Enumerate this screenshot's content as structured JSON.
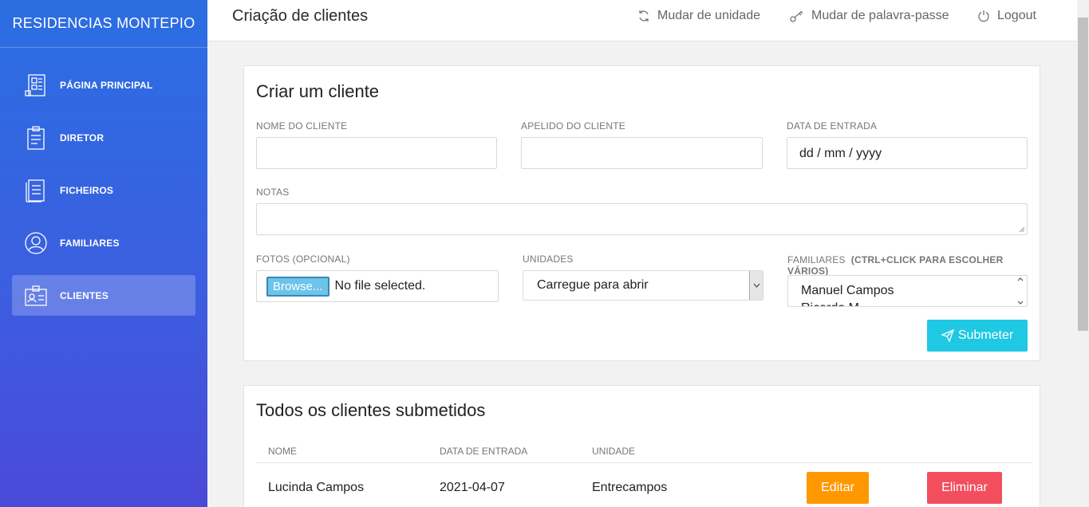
{
  "brand": "RESIDENCIAS MONTEPIO",
  "sidebar": {
    "items": [
      {
        "label": "PÁGINA PRINCIPAL",
        "icon": "dashboard-icon"
      },
      {
        "label": "DIRETOR",
        "icon": "clipboard-icon"
      },
      {
        "label": "FICHEIROS",
        "icon": "document-icon"
      },
      {
        "label": "FAMILIARES",
        "icon": "user-icon"
      },
      {
        "label": "CLIENTES",
        "icon": "id-card-icon",
        "active": true
      }
    ]
  },
  "header": {
    "title": "Criação de clientes",
    "change_unit": "Mudar de unidade",
    "change_password": "Mudar de palavra-passe",
    "logout": "Logout"
  },
  "create_form": {
    "title": "Criar um cliente",
    "name_label": "NOME DO CLIENTE",
    "name_value": "",
    "surname_label": "APELIDO DO CLIENTE",
    "surname_value": "",
    "entry_date_label": "DATA DE ENTRADA",
    "entry_date_placeholder": "dd / mm / yyyy",
    "notes_label": "NOTAS",
    "notes_value": "",
    "photos_label": "FOTOS (OPCIONAL)",
    "browse_label": "Browse...",
    "file_status": "No file selected.",
    "units_label": "UNIDADES",
    "units_selected": "Carregue para abrir",
    "family_label": "FAMILIARES",
    "family_hint": "(CTRL+CLICK PARA ESCOLHER VÁRIOS)",
    "family_options": [
      "Manuel Campos",
      "Ricardo M..."
    ],
    "submit_label": "Submeter"
  },
  "clients_table": {
    "title": "Todos os clientes submetidos",
    "columns": [
      "NOME",
      "DATA DE ENTRADA",
      "UNIDADE"
    ],
    "rows": [
      {
        "name": "Lucinda Campos",
        "entry_date": "2021-04-07",
        "unit": "Entrecampos",
        "edit": "Editar",
        "delete": "Eliminar"
      }
    ]
  },
  "colors": {
    "sidebar_top": "#2b6ee2",
    "sidebar_bottom": "#4a49d8",
    "submit": "#1fc8e3",
    "edit": "#ff9800",
    "delete": "#f24e5e"
  }
}
